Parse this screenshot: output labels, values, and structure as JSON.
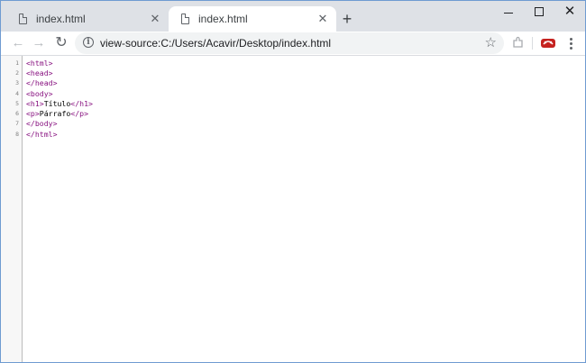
{
  "tabs": [
    {
      "title": "index.html",
      "active": false
    },
    {
      "title": "index.html",
      "active": true
    }
  ],
  "new_tab_glyph": "+",
  "window_controls": {
    "close_glyph": "✕"
  },
  "nav": {
    "back_glyph": "←",
    "forward_glyph": "→",
    "reload_glyph": "↻"
  },
  "address_bar": {
    "url": "view-source:C:/Users/Acavir/Desktop/index.html",
    "star_glyph": "☆"
  },
  "source_lines": [
    {
      "num": "1",
      "parts": [
        {
          "t": "tag",
          "v": "<html>"
        }
      ]
    },
    {
      "num": "2",
      "parts": [
        {
          "t": "tag",
          "v": "<head>"
        }
      ]
    },
    {
      "num": "3",
      "parts": [
        {
          "t": "tag",
          "v": "</head>"
        }
      ]
    },
    {
      "num": "4",
      "parts": [
        {
          "t": "tag",
          "v": "<body>"
        }
      ]
    },
    {
      "num": "5",
      "parts": [
        {
          "t": "tag",
          "v": "<h1>"
        },
        {
          "t": "txt",
          "v": "Título"
        },
        {
          "t": "tag",
          "v": "</h1>"
        }
      ]
    },
    {
      "num": "6",
      "parts": [
        {
          "t": "tag",
          "v": "<p>"
        },
        {
          "t": "txt",
          "v": "Párrafo"
        },
        {
          "t": "tag",
          "v": "</p>"
        }
      ]
    },
    {
      "num": "7",
      "parts": [
        {
          "t": "tag",
          "v": "</body>"
        }
      ]
    },
    {
      "num": "8",
      "parts": [
        {
          "t": "tag",
          "v": "</html>"
        }
      ]
    }
  ],
  "colors": {
    "tag": "#881280",
    "text": "#000000",
    "tab_strip": "#dee1e6"
  }
}
